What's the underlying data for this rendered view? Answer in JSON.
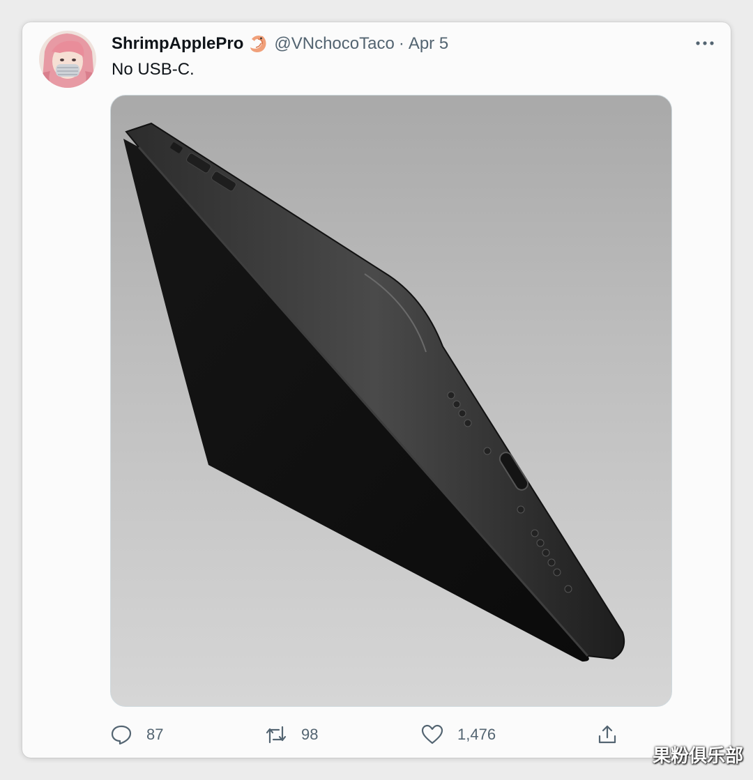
{
  "tweet": {
    "display_name": "ShrimpApplePro",
    "name_emoji": "shrimp-emoji",
    "handle": "@VNchocoTaco",
    "separator": "·",
    "date": "Apr 5",
    "text": "No USB-C.",
    "media_image": "phone-render"
  },
  "actions": {
    "replies": "87",
    "retweets": "98",
    "likes": "1,476",
    "reply_icon": "reply-icon",
    "retweet_icon": "retweet-icon",
    "like_icon": "heart-icon",
    "share_icon": "share-icon"
  },
  "more_icon": "more-icon",
  "watermark": "果粉俱乐部",
  "colors": {
    "primary_text": "#0f1419",
    "secondary_text": "#536471",
    "card_bg": "#fbfbfb",
    "page_bg": "#ececec"
  }
}
